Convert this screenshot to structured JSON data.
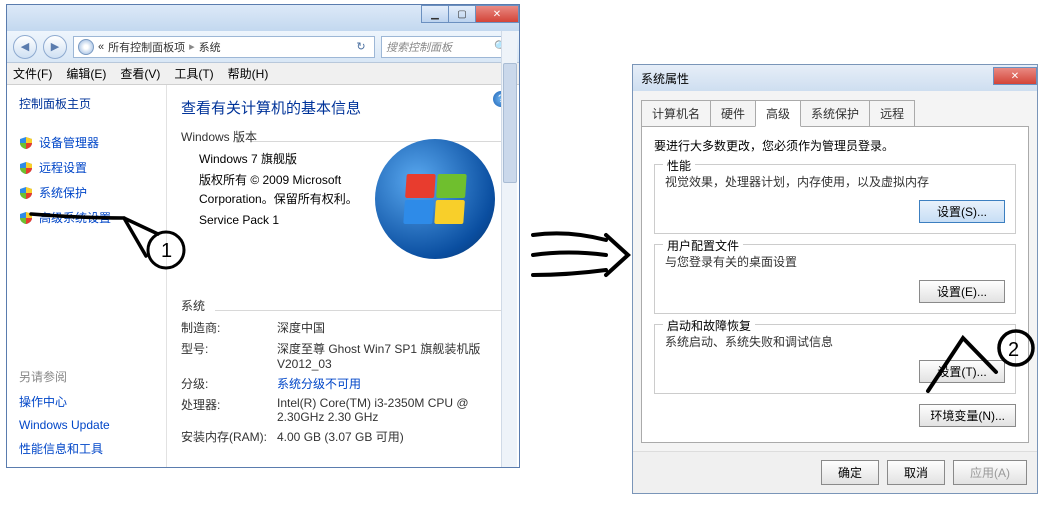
{
  "left": {
    "nav": {
      "back_glyph": "◀",
      "forward_glyph": "▶"
    },
    "address": {
      "seg1": "所有控制面板项",
      "seg2": "系统",
      "refresh_glyph": "↻"
    },
    "search": {
      "placeholder": "搜索控制面板",
      "mag_glyph": "🔍"
    },
    "menu": {
      "file": "文件(F)",
      "edit": "编辑(E)",
      "view": "查看(V)",
      "tools": "工具(T)",
      "help": "帮助(H)"
    },
    "sidebar": {
      "home": "控制面板主页",
      "items": [
        {
          "label": "设备管理器"
        },
        {
          "label": "远程设置"
        },
        {
          "label": "系统保护"
        },
        {
          "label": "高级系统设置"
        }
      ],
      "seealso_title": "另请参阅",
      "seealso": [
        {
          "label": "操作中心"
        },
        {
          "label": "Windows Update"
        },
        {
          "label": "性能信息和工具"
        }
      ]
    },
    "main": {
      "help_glyph": "?",
      "heading": "查看有关计算机的基本信息",
      "edition_section": "Windows 版本",
      "edition": "Windows 7 旗舰版",
      "copyright1": "版权所有 © 2009 Microsoft",
      "copyright2": "Corporation。保留所有权利。",
      "sp": "Service Pack 1",
      "system_section": "系统",
      "rows": {
        "mfg_label": "制造商:",
        "mfg_val": "深度中国",
        "model_label": "型号:",
        "model_val": "深度至尊 Ghost Win7 SP1 旗舰装机版 V2012_03",
        "rating_label": "分级:",
        "rating_val": "系统分级不可用",
        "cpu_label": "处理器:",
        "cpu_val": "Intel(R) Core(TM) i3-2350M CPU @ 2.30GHz  2.30 GHz",
        "ram_label": "安装内存(RAM):",
        "ram_val": "4.00 GB (3.07 GB 可用)"
      }
    },
    "winctrl": {
      "min": "▁",
      "max": "▢",
      "close": "✕"
    }
  },
  "right": {
    "title": "系统属性",
    "close": "✕",
    "tabs": {
      "t1": "计算机名",
      "t2": "硬件",
      "t3": "高级",
      "t4": "系统保护",
      "t5": "远程"
    },
    "admin_note": "要进行大多数更改，您必须作为管理员登录。",
    "perf": {
      "legend": "性能",
      "desc": "视觉效果，处理器计划，内存使用，以及虚拟内存",
      "btn": "设置(S)..."
    },
    "prof": {
      "legend": "用户配置文件",
      "desc": "与您登录有关的桌面设置",
      "btn": "设置(E)..."
    },
    "startup": {
      "legend": "启动和故障恢复",
      "desc": "系统启动、系统失败和调试信息",
      "btn": "设置(T)..."
    },
    "envbtn": "环境变量(N)...",
    "buttons": {
      "ok": "确定",
      "cancel": "取消",
      "apply": "应用(A)"
    }
  }
}
